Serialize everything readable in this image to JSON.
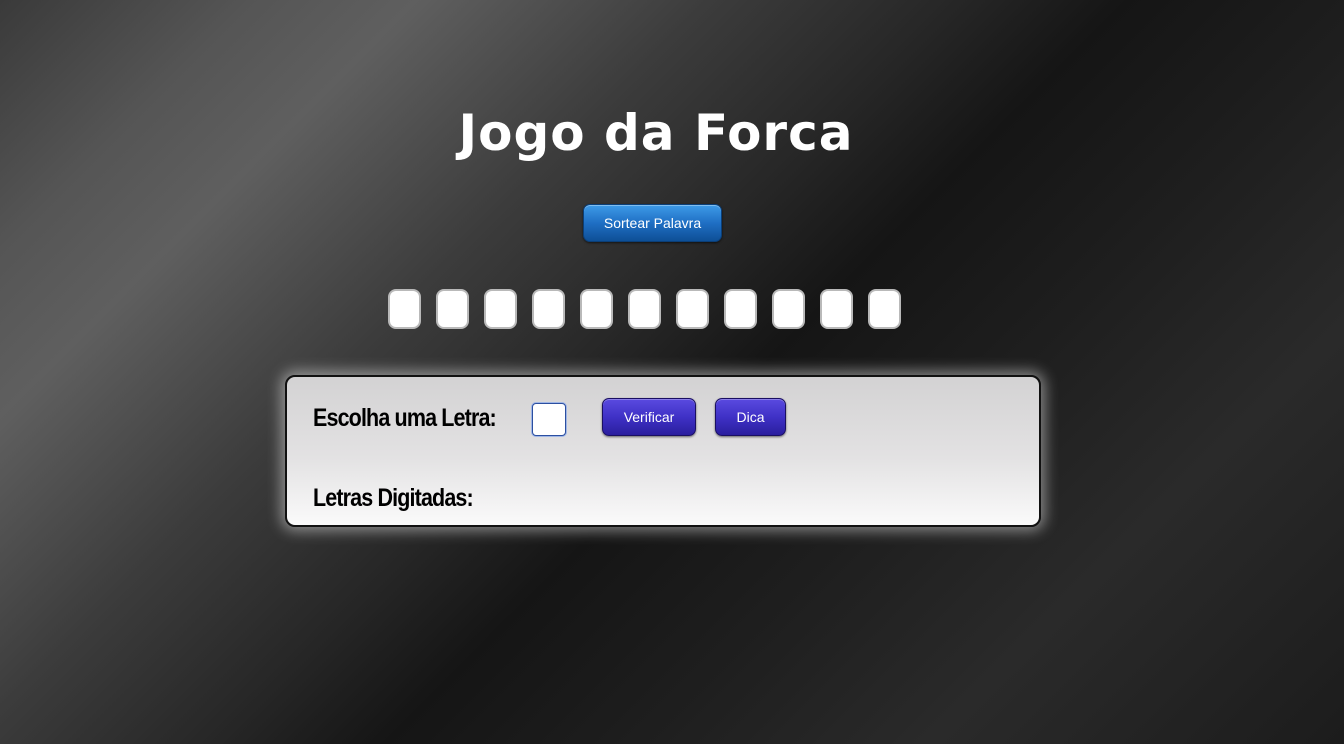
{
  "title": "Jogo da Forca",
  "controls": {
    "sortear_label": "Sortear Palavra",
    "verificar_label": "Verificar",
    "dica_label": "Dica"
  },
  "word": {
    "letter_slots": [
      "",
      "",
      "",
      "",
      "",
      "",
      "",
      "",
      "",
      "",
      ""
    ]
  },
  "panel": {
    "escolha_label": "Escolha uma Letra:",
    "letter_input_value": "",
    "letras_digitadas_label": "Letras Digitadas:",
    "letras_digitadas_value": ""
  },
  "colors": {
    "sortear_button": "#1f6fc4",
    "action_buttons": "#3f31c6",
    "panel_background": "#e3e2e3",
    "title_text": "#ffffff"
  }
}
